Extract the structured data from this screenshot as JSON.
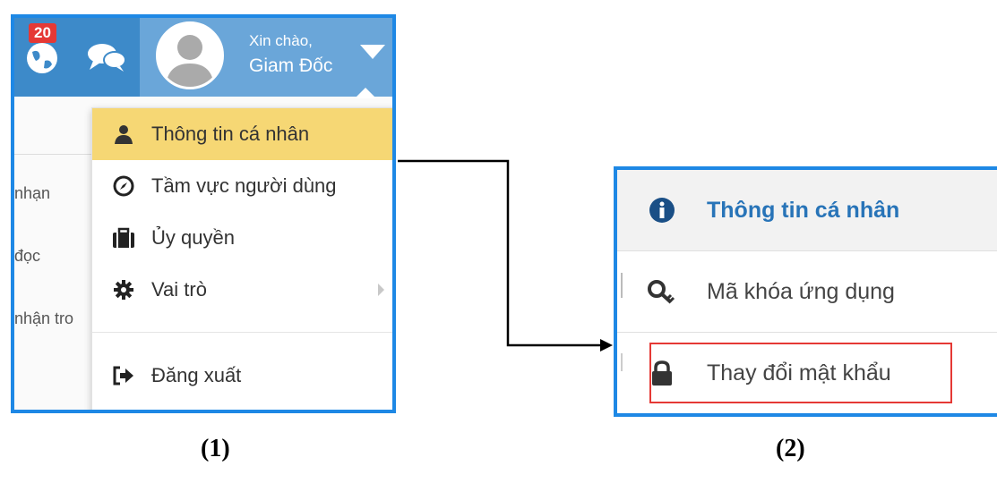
{
  "panel1": {
    "notification_count": "20",
    "greeting": "Xin chào,",
    "username": "Giam Đốc",
    "background_items": [
      "nhạn",
      "đọc",
      "nhận tro"
    ],
    "menu": [
      {
        "label": "Thông tin cá nhân",
        "icon": "user-icon",
        "active": true
      },
      {
        "label": "Tầm vực người dùng",
        "icon": "compass-icon"
      },
      {
        "label": "Ủy quyền",
        "icon": "briefcase-icon"
      },
      {
        "label": "Vai trò",
        "icon": "gear-icon",
        "has_submenu": true
      },
      {
        "label": "Đăng xuất",
        "icon": "sign-out-icon"
      }
    ],
    "colors": {
      "topbar": "#3d8ac9",
      "user_area": "#6aa6d9",
      "active_item": "#f6d774",
      "badge": "#e53935"
    }
  },
  "panel2": {
    "items": [
      {
        "label": "Thông tin cá nhân",
        "icon": "info-circle-icon"
      },
      {
        "label": "Mã khóa ứng dụng",
        "icon": "key-icon"
      },
      {
        "label": "Thay đổi mật khẩu",
        "icon": "lock-icon",
        "highlighted": true
      }
    ],
    "colors": {
      "title": "#2874b8",
      "highlight_border": "#e53935"
    }
  },
  "captions": [
    "(1)",
    "(2)"
  ],
  "colors": {
    "panel_border": "#1e88e5"
  }
}
